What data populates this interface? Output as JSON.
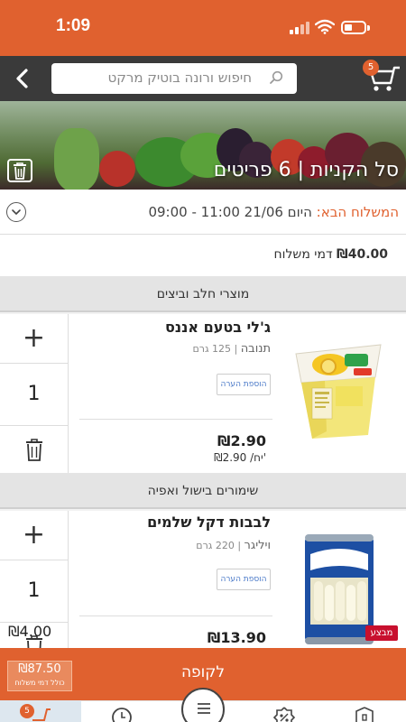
{
  "status_bar": {
    "time": "1:09"
  },
  "header": {
    "search_placeholder": "חיפוש ורונה בוטיק מרקט",
    "cart_count": "5"
  },
  "hero": {
    "title": "סל הקניות | 6 פריטים"
  },
  "delivery": {
    "label": "המשלוח הבא:",
    "value": " היום 21/06 11:00 - 09:00"
  },
  "fee": {
    "amount": "₪40.00",
    "label": "דמי משלוח"
  },
  "categories": [
    {
      "label": "מוצרי חלב וביצים"
    },
    {
      "label": "שימורים בישול ואפיה"
    }
  ],
  "items": [
    {
      "name": "ג'לי בטעם אננס",
      "brand": "תנובה",
      "size": "125 גרם",
      "note_label": "הוספת הערה",
      "quantity": "1",
      "price": "₪2.90",
      "unit_price": "₪2.90 /יח'"
    },
    {
      "name": "לבבות דקל שלמים",
      "brand": "ויליגר",
      "size": "220 גרם",
      "note_label": "הוספת הערה",
      "quantity": "1",
      "price": "₪13.90",
      "sale_badge": "מבצע"
    }
  ],
  "overlap_price": "₪4.00",
  "checkout": {
    "label": "לקופה",
    "total": "₪87.50",
    "total_note": "כולל דמי משלוח"
  },
  "tab_bar": {
    "cart_badge": "5"
  },
  "colors": {
    "accent": "#e0612f",
    "nav": "#3a3a3a",
    "link": "#4a79c8"
  }
}
